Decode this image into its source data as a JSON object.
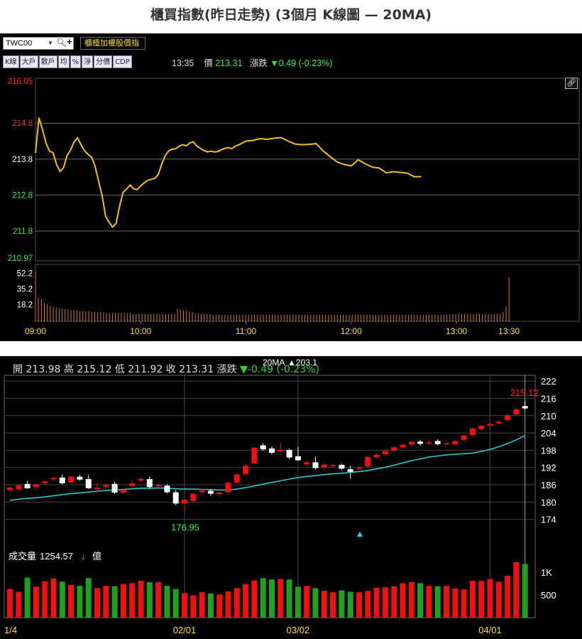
{
  "title": "櫃買指數(昨日走勢) (3個月 K線圖  — 20MA)",
  "toolbar": {
    "symbol": "TWC00",
    "index_name": "櫃檯加權股價指",
    "buttons": [
      "K線",
      "大戶",
      "散戶",
      "均",
      "%",
      "淨",
      "分價",
      "CDP"
    ]
  },
  "quote": {
    "time": "13:35",
    "price_label": "價",
    "price": "213.31",
    "change_label": "漲跌",
    "change": "▼0.49 (-0.23%)"
  },
  "colors": {
    "intraday_line": "#f0c020",
    "volume": "#d07f2a",
    "ma_line": "#2cc7c7",
    "up_bar": "#ee1111",
    "down_bar": "#20a020",
    "up_text": "#ff2222",
    "down_text": "#33ee33"
  },
  "chart_data": [
    {
      "type": "line",
      "title": "",
      "ylim": [
        210.97,
        216.05
      ],
      "y_ticks": [
        {
          "label": "216.05",
          "value": 216.05,
          "color": "up"
        },
        {
          "label": "214.8",
          "value": 214.8,
          "color": "up"
        },
        {
          "label": "213.8",
          "value": 213.8,
          "color": "flat"
        },
        {
          "label": "212.8",
          "value": 212.8,
          "color": "down"
        },
        {
          "label": "211.8",
          "value": 211.8,
          "color": "down"
        },
        {
          "label": "210.97",
          "value": 210.97,
          "color": "down"
        }
      ],
      "x_ticks": [
        "09:00",
        "10:00",
        "11:00",
        "12:00",
        "13:00",
        "13:30"
      ],
      "x_tick_minutes": [
        0,
        60,
        120,
        180,
        240,
        270
      ],
      "x_range_minutes": [
        0,
        310
      ],
      "price": {
        "minutes": [
          0,
          2,
          4,
          6,
          8,
          10,
          12,
          14,
          16,
          18,
          20,
          22,
          24,
          26,
          28,
          30,
          32,
          34,
          36,
          38,
          40,
          42,
          44,
          46,
          48,
          50,
          52,
          54,
          56,
          58,
          60,
          62,
          64,
          66,
          68,
          70,
          72,
          74,
          76,
          78,
          80,
          82,
          84,
          86,
          88,
          90,
          92,
          94,
          96,
          98,
          100,
          102,
          104,
          106,
          108,
          110,
          112,
          114,
          116,
          118,
          120,
          124,
          128,
          132,
          136,
          140,
          144,
          148,
          152,
          156,
          160,
          164,
          168,
          172,
          176,
          180,
          184,
          188,
          192,
          196,
          200,
          204,
          208,
          212,
          216,
          220,
          224,
          228,
          232,
          236,
          240,
          244,
          248,
          252,
          256,
          260,
          264,
          268,
          270
        ],
        "values": [
          213.97,
          214.95,
          214.62,
          214.25,
          214.02,
          213.98,
          213.65,
          213.46,
          213.56,
          213.9,
          214.05,
          214.28,
          214.39,
          214.2,
          214.03,
          213.93,
          213.85,
          213.6,
          213.18,
          212.78,
          212.21,
          212.04,
          211.91,
          212.02,
          212.5,
          212.88,
          212.97,
          213.08,
          212.97,
          212.95,
          213.06,
          213.14,
          213.21,
          213.24,
          213.26,
          213.37,
          213.66,
          213.9,
          214.03,
          214.08,
          214.09,
          214.16,
          214.2,
          214.17,
          214.25,
          214.28,
          214.16,
          214.1,
          214.04,
          214.0,
          214.02,
          214.0,
          214.01,
          214.06,
          214.1,
          214.12,
          214.09,
          214.16,
          214.2,
          214.25,
          214.3,
          214.32,
          214.37,
          214.35,
          214.38,
          214.4,
          214.3,
          214.22,
          214.2,
          214.21,
          214.23,
          214.03,
          213.87,
          213.72,
          213.65,
          213.61,
          213.78,
          213.67,
          213.58,
          213.55,
          213.42,
          213.45,
          213.43,
          213.41,
          213.31,
          213.31
        ],
        "close": 213.31
      },
      "volume": {
        "y_ticks": [
          {
            "label": "52.2",
            "value": 52.2
          },
          {
            "label": "35.2",
            "value": 35.2
          },
          {
            "label": "18.2",
            "value": 18.2
          }
        ],
        "ylim": [
          0,
          62
        ],
        "values": [
          55,
          26,
          24,
          20,
          19,
          17,
          16,
          15,
          14,
          14,
          13,
          13,
          12,
          12,
          12,
          11,
          11,
          11,
          11,
          10,
          10,
          10,
          10,
          10,
          9,
          9,
          9,
          9,
          9,
          9,
          9,
          9,
          9,
          8,
          8,
          8,
          8,
          8,
          8,
          8,
          8,
          8,
          8,
          8,
          8,
          8,
          8,
          8,
          14,
          13,
          12,
          11,
          10,
          10,
          9,
          9,
          8,
          8,
          8,
          8,
          7,
          7,
          7,
          7,
          7,
          7,
          7,
          7,
          7,
          7,
          7,
          7,
          7,
          7,
          7,
          7,
          7,
          7,
          7,
          7,
          7,
          7,
          7,
          7,
          7,
          7,
          7,
          7,
          7,
          7,
          7,
          7,
          7,
          7,
          7,
          7,
          7,
          7,
          7,
          7,
          7,
          7,
          7,
          7,
          7,
          7,
          7,
          7,
          7,
          7,
          7,
          7,
          7,
          7,
          7,
          7,
          7,
          7,
          7,
          7,
          7,
          7,
          7,
          7,
          7,
          7,
          7,
          7,
          7,
          7,
          7,
          7,
          7,
          7,
          7,
          7,
          7,
          7,
          7,
          7,
          8,
          8,
          8,
          8,
          8,
          8,
          8,
          8,
          8,
          8,
          8,
          8,
          8,
          8,
          8,
          8,
          8,
          8,
          10,
          16,
          48
        ],
        "last_spike": 48
      }
    },
    {
      "type": "bar",
      "title": "",
      "header": {
        "open_label": "開",
        "open": "213.98",
        "high_label": "高",
        "high": "215.12",
        "low_label": "低",
        "low": "211.92",
        "close_label": "收",
        "close": "213.31",
        "change_label": "漲跌",
        "change": "▼-0.49 (-0.23%)",
        "ma_label": "20MA",
        "ma_value": "▲203.1"
      },
      "ylim": [
        168,
        224
      ],
      "y_ticks": [
        222,
        216,
        210,
        204,
        198,
        192,
        186,
        180,
        174
      ],
      "x_ticks": [
        {
          "label": "1/4",
          "index": 0
        },
        {
          "label": "02/01",
          "index": 20
        },
        {
          "label": "03/02",
          "index": 33
        },
        {
          "label": "04/01",
          "index": 55
        }
      ],
      "annotations": {
        "low_label": "176.95",
        "low_index": 20,
        "low_value": 176.95,
        "high_label": "215.12",
        "high_index": 59,
        "high_value": 215.12
      },
      "candles": [
        {
          "o": 184.2,
          "h": 185.2,
          "l": 183.6,
          "c": 185.0,
          "up": true
        },
        {
          "o": 184.5,
          "h": 186.3,
          "l": 183.9,
          "c": 185.8,
          "up": true
        },
        {
          "o": 186.3,
          "h": 187.4,
          "l": 184.6,
          "c": 184.8,
          "up": false
        },
        {
          "o": 185.2,
          "h": 186.3,
          "l": 184.3,
          "c": 186.2,
          "up": true
        },
        {
          "o": 186.6,
          "h": 187.5,
          "l": 185.9,
          "c": 187.2,
          "up": true
        },
        {
          "o": 187.9,
          "h": 188.8,
          "l": 187.2,
          "c": 188.4,
          "up": true
        },
        {
          "o": 188.5,
          "h": 189.6,
          "l": 186.2,
          "c": 186.5,
          "up": false
        },
        {
          "o": 186.8,
          "h": 189.1,
          "l": 186.3,
          "c": 188.8,
          "up": true
        },
        {
          "o": 188.8,
          "h": 189.5,
          "l": 187.4,
          "c": 187.8,
          "up": false
        },
        {
          "o": 188.0,
          "h": 189.4,
          "l": 184.5,
          "c": 184.8,
          "up": false
        },
        {
          "o": 184.5,
          "h": 186.8,
          "l": 183.0,
          "c": 185.0,
          "up": true
        },
        {
          "o": 185.3,
          "h": 186.6,
          "l": 184.6,
          "c": 186.0,
          "up": true
        },
        {
          "o": 186.3,
          "h": 187.0,
          "l": 182.8,
          "c": 183.3,
          "up": false
        },
        {
          "o": 183.3,
          "h": 184.5,
          "l": 182.8,
          "c": 184.3,
          "up": true
        },
        {
          "o": 185.6,
          "h": 187.4,
          "l": 185.0,
          "c": 186.5,
          "up": true
        },
        {
          "o": 187.5,
          "h": 188.6,
          "l": 187.0,
          "c": 188.0,
          "up": true
        },
        {
          "o": 188.0,
          "h": 188.9,
          "l": 184.7,
          "c": 185.2,
          "up": false
        },
        {
          "o": 185.5,
          "h": 186.4,
          "l": 185.0,
          "c": 185.9,
          "up": true
        },
        {
          "o": 185.7,
          "h": 186.2,
          "l": 183.0,
          "c": 183.4,
          "up": false
        },
        {
          "o": 183.4,
          "h": 184.1,
          "l": 178.9,
          "c": 179.5,
          "up": false
        },
        {
          "o": 179.5,
          "h": 181.2,
          "l": 176.95,
          "c": 180.8,
          "up": true
        },
        {
          "o": 180.4,
          "h": 183.2,
          "l": 180.0,
          "c": 182.9,
          "up": true
        },
        {
          "o": 183.4,
          "h": 184.6,
          "l": 182.8,
          "c": 184.0,
          "up": true
        },
        {
          "o": 183.9,
          "h": 184.6,
          "l": 182.1,
          "c": 182.9,
          "up": false
        },
        {
          "o": 182.8,
          "h": 183.6,
          "l": 182.1,
          "c": 183.3,
          "up": true
        },
        {
          "o": 183.4,
          "h": 187.1,
          "l": 183.1,
          "c": 186.7,
          "up": true
        },
        {
          "o": 186.8,
          "h": 189.9,
          "l": 186.4,
          "c": 189.6,
          "up": true
        },
        {
          "o": 189.7,
          "h": 193.1,
          "l": 189.4,
          "c": 192.6,
          "up": true
        },
        {
          "o": 193.4,
          "h": 199.2,
          "l": 193.1,
          "c": 198.9,
          "up": true
        },
        {
          "o": 199.7,
          "h": 200.4,
          "l": 197.8,
          "c": 198.3,
          "up": false
        },
        {
          "o": 198.6,
          "h": 199.4,
          "l": 196.5,
          "c": 197.1,
          "up": false
        },
        {
          "o": 197.5,
          "h": 200.5,
          "l": 197.3,
          "c": 198.1,
          "up": true
        },
        {
          "o": 198.1,
          "h": 198.5,
          "l": 194.9,
          "c": 195.5,
          "up": false
        },
        {
          "o": 195.9,
          "h": 199.2,
          "l": 194.3,
          "c": 194.5,
          "up": false
        },
        {
          "o": 193.1,
          "h": 194.4,
          "l": 192.5,
          "c": 193.8,
          "up": true
        },
        {
          "o": 193.8,
          "h": 195.7,
          "l": 191.3,
          "c": 191.8,
          "up": false
        },
        {
          "o": 192.1,
          "h": 193.4,
          "l": 191.4,
          "c": 193.0,
          "up": true
        },
        {
          "o": 192.5,
          "h": 193.3,
          "l": 192.0,
          "c": 192.8,
          "up": true
        },
        {
          "o": 192.9,
          "h": 193.3,
          "l": 191.1,
          "c": 191.6,
          "up": false
        },
        {
          "o": 191.4,
          "h": 192.6,
          "l": 188.1,
          "c": 190.5,
          "up": false
        },
        {
          "o": 191.6,
          "h": 192.6,
          "l": 190.9,
          "c": 191.9,
          "up": true
        },
        {
          "o": 192.4,
          "h": 196.0,
          "l": 192.0,
          "c": 195.6,
          "up": true
        },
        {
          "o": 195.5,
          "h": 196.8,
          "l": 195.0,
          "c": 196.4,
          "up": true
        },
        {
          "o": 196.6,
          "h": 198.0,
          "l": 196.2,
          "c": 197.7,
          "up": true
        },
        {
          "o": 197.8,
          "h": 199.4,
          "l": 197.4,
          "c": 199.0,
          "up": true
        },
        {
          "o": 199.0,
          "h": 200.3,
          "l": 198.6,
          "c": 199.9,
          "up": true
        },
        {
          "o": 200.0,
          "h": 201.2,
          "l": 199.6,
          "c": 200.9,
          "up": true
        },
        {
          "o": 201.0,
          "h": 201.6,
          "l": 199.6,
          "c": 200.2,
          "up": false
        },
        {
          "o": 200.3,
          "h": 201.3,
          "l": 199.8,
          "c": 200.7,
          "up": true
        },
        {
          "o": 201.2,
          "h": 201.8,
          "l": 199.6,
          "c": 200.1,
          "up": false
        },
        {
          "o": 200.3,
          "h": 200.9,
          "l": 199.6,
          "c": 200.4,
          "up": true
        },
        {
          "o": 200.1,
          "h": 201.5,
          "l": 199.8,
          "c": 201.2,
          "up": true
        },
        {
          "o": 201.6,
          "h": 203.5,
          "l": 201.3,
          "c": 203.1,
          "up": true
        },
        {
          "o": 203.2,
          "h": 205.9,
          "l": 203.0,
          "c": 205.6,
          "up": true
        },
        {
          "o": 205.3,
          "h": 206.8,
          "l": 204.8,
          "c": 206.5,
          "up": true
        },
        {
          "o": 206.5,
          "h": 207.5,
          "l": 206.0,
          "c": 207.1,
          "up": true
        },
        {
          "o": 207.3,
          "h": 208.4,
          "l": 206.9,
          "c": 207.9,
          "up": true
        },
        {
          "o": 208.5,
          "h": 210.6,
          "l": 208.1,
          "c": 210.2,
          "up": true
        },
        {
          "o": 210.4,
          "h": 212.6,
          "l": 210.0,
          "c": 212.2,
          "up": true
        },
        {
          "o": 212.5,
          "h": 215.12,
          "l": 211.92,
          "c": 213.31,
          "up": false
        }
      ],
      "ma20": [
        180.6,
        181.0,
        181.3,
        181.5,
        181.8,
        182.2,
        182.6,
        182.9,
        183.2,
        183.5,
        183.8,
        184.0,
        184.2,
        184.4,
        184.6,
        184.8,
        184.8,
        184.9,
        184.8,
        184.6,
        184.5,
        184.5,
        184.4,
        184.3,
        184.2,
        184.2,
        184.5,
        185.0,
        185.6,
        186.2,
        186.8,
        187.4,
        188.0,
        188.5,
        188.9,
        189.2,
        189.5,
        189.8,
        190.0,
        190.3,
        190.6,
        191.0,
        191.5,
        192.1,
        192.8,
        193.6,
        194.4,
        195.0,
        195.6,
        196.0,
        196.4,
        196.6,
        196.8,
        197.0,
        197.6,
        198.3,
        199.2,
        200.3,
        201.6,
        203.1
      ],
      "volume": {
        "label": "成交量",
        "value": "1254.57",
        "arrow": "↓",
        "unit": "億",
        "ylim": [
          0,
          1500
        ],
        "y_ticks": [
          {
            "label": "1K",
            "value": 1000
          },
          {
            "label": "500",
            "value": 500
          }
        ],
        "values": [
          630,
          570,
          880,
          680,
          800,
          860,
          790,
          720,
          700,
          870,
          650,
          700,
          690,
          740,
          760,
          810,
          780,
          780,
          700,
          630,
          540,
          490,
          560,
          530,
          510,
          580,
          650,
          740,
          820,
          870,
          840,
          850,
          840,
          680,
          700,
          650,
          590,
          560,
          600,
          570,
          560,
          590,
          660,
          670,
          690,
          760,
          780,
          760,
          700,
          690,
          700,
          640,
          620,
          810,
          810,
          850,
          790,
          920,
          1220,
          1180
        ]
      }
    }
  ]
}
